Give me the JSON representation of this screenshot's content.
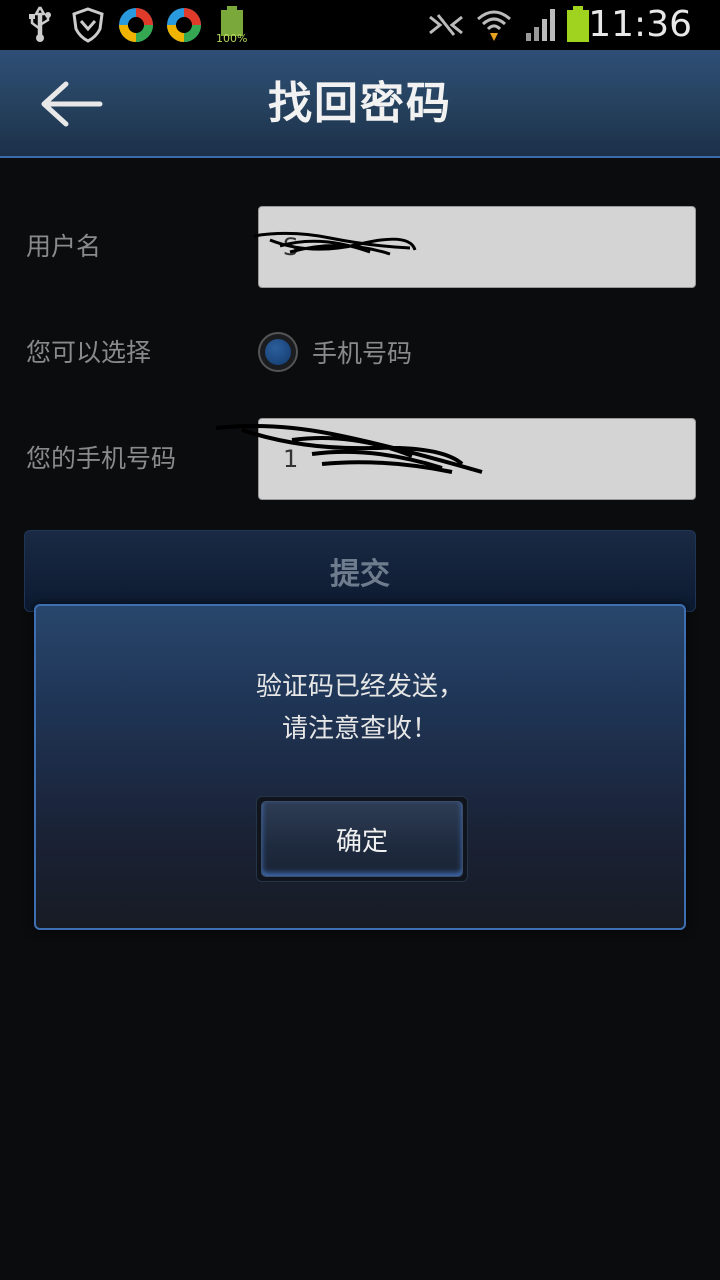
{
  "status_bar": {
    "time": "11:36",
    "battery_percent": "100%",
    "icons": [
      "usb-icon",
      "shield-icon",
      "app-circle-icon",
      "app-circle-icon",
      "battery-icon",
      "nfc-icon",
      "wifi-icon",
      "signal-icon",
      "battery-icon"
    ]
  },
  "header": {
    "title": "找回密码"
  },
  "form": {
    "username_label": "用户名",
    "username_value": "S",
    "choice_label": "您可以选择",
    "choice_option": "手机号码",
    "phone_label": "您的手机号码",
    "phone_value": "1",
    "submit_label": "提交"
  },
  "dialog": {
    "message_line1": "验证码已经发送，",
    "message_line2": "请注意查收！",
    "ok_label": "确定"
  },
  "colors": {
    "header_bg": "#26425f",
    "accent": "#3f6fb3",
    "battery": "#9fd31f"
  }
}
